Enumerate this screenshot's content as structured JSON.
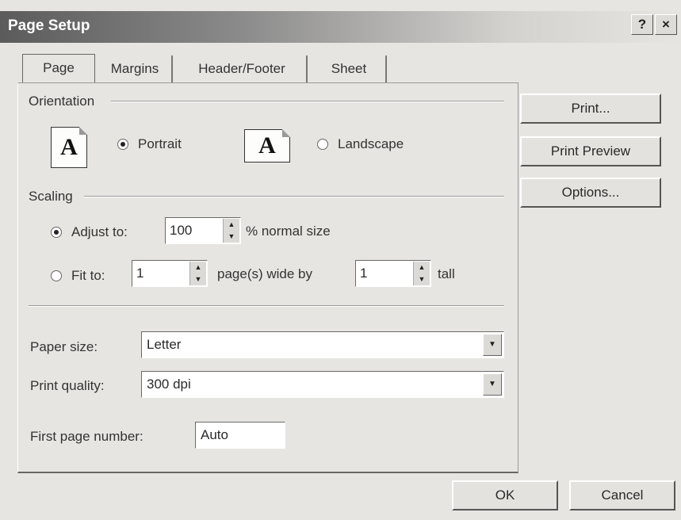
{
  "window": {
    "title": "Page Setup",
    "help_label": "?",
    "close_label": "×"
  },
  "tabs": [
    {
      "label": "Page",
      "active": true
    },
    {
      "label": "Margins",
      "active": false
    },
    {
      "label": "Header/Footer",
      "active": false
    },
    {
      "label": "Sheet",
      "active": false
    }
  ],
  "orientation": {
    "label": "Orientation",
    "icon_letter": "A",
    "portrait_label": "Portrait",
    "landscape_label": "Landscape",
    "selected": "Portrait"
  },
  "scaling": {
    "label": "Scaling",
    "adjust_to_label": "Adjust to:",
    "adjust_to_value": "100",
    "adjust_to_suffix": "% normal size",
    "fit_to_label": "Fit to:",
    "fit_wide_value": "1",
    "fit_wide_suffix": "page(s) wide by",
    "fit_tall_value": "1",
    "fit_tall_suffix": "tall",
    "selected": "Adjust to"
  },
  "paper_size": {
    "label": "Paper size:",
    "value": "Letter"
  },
  "print_quality": {
    "label": "Print quality:",
    "value": "300 dpi"
  },
  "first_page_number": {
    "label": "First page number:",
    "value": "Auto"
  },
  "side_buttons": {
    "print": "Print...",
    "print_preview": "Print Preview",
    "options": "Options..."
  },
  "footer_buttons": {
    "ok": "OK",
    "cancel": "Cancel"
  },
  "spin_up_glyph": "▲",
  "spin_down_glyph": "▼",
  "dropdown_glyph": "▼"
}
